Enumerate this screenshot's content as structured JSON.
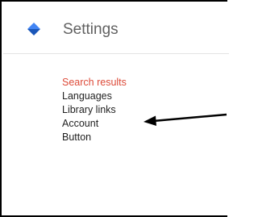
{
  "header": {
    "title": "Settings",
    "logo_icon": "diamond-logo-icon",
    "logo_colors": {
      "top": "#4285f4",
      "bottom": "#1a56b8"
    }
  },
  "menu": {
    "items": [
      {
        "label": "Search results",
        "active": true
      },
      {
        "label": "Languages",
        "active": false
      },
      {
        "label": "Library links",
        "active": false
      },
      {
        "label": "Account",
        "active": false
      },
      {
        "label": "Button",
        "active": false
      }
    ],
    "active_color": "#dd4b39"
  },
  "annotation": {
    "icon": "arrow-left-icon",
    "target": "Library links",
    "color": "#000000"
  }
}
